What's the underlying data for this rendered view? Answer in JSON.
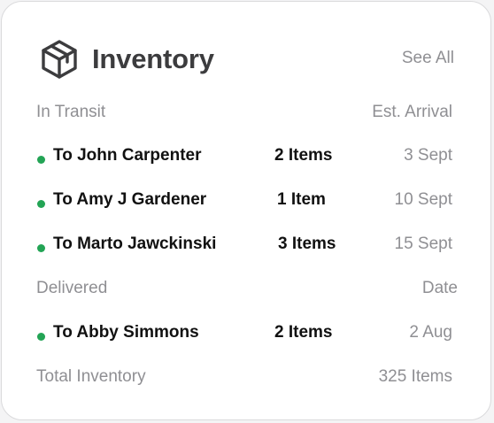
{
  "widget": {
    "title": "Inventory",
    "title_icon": "box-icon",
    "see_all_label": "See All"
  },
  "in_transit": {
    "header_label": "In Transit",
    "header_right": "Est. Arrival",
    "items": [
      {
        "name": "To John Carpenter",
        "count": "2 Items",
        "date": "3 Sept"
      },
      {
        "name": "To Amy J Gardener",
        "count": "1 Item",
        "date": "10 Sept"
      },
      {
        "name": "To Marto Jawckinski",
        "count": "3 Items",
        "date": "15 Sept"
      }
    ]
  },
  "delivered": {
    "header_label": "Delivered",
    "header_right": "Date",
    "items": [
      {
        "name": "To Abby Simmons",
        "count": "2 Items",
        "date": "2 Aug"
      }
    ]
  },
  "total": {
    "label": "Total Inventory",
    "value": "325 Items"
  },
  "colors": {
    "status_dot": "#23a455",
    "muted_text": "#8f8f93",
    "title_text": "#3c3c3e"
  }
}
